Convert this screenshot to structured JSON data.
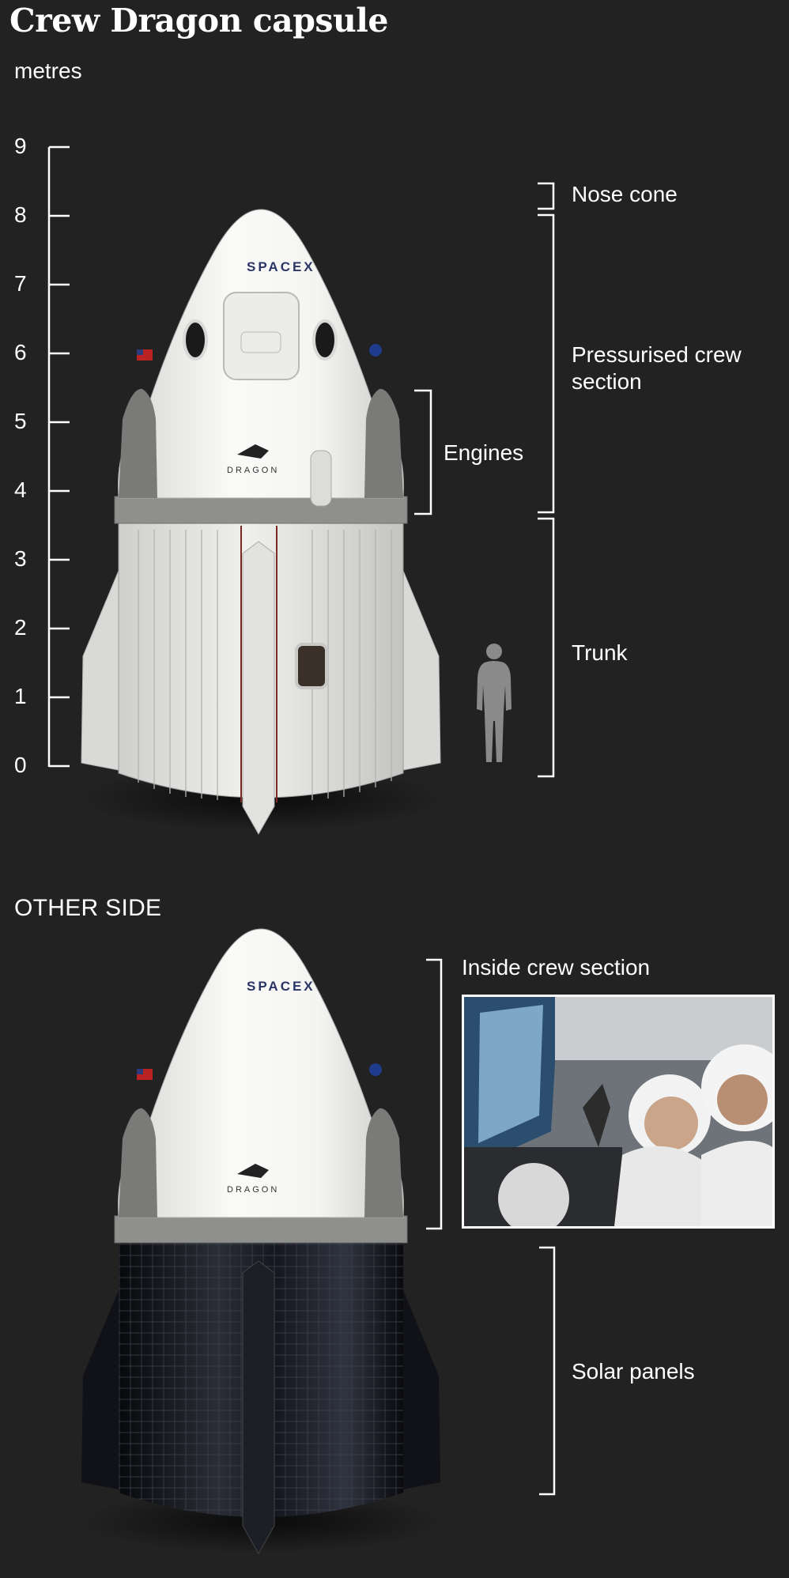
{
  "title": "Crew Dragon capsule",
  "units": "metres",
  "scale": {
    "ticks": [
      "0",
      "1",
      "2",
      "3",
      "4",
      "5",
      "6",
      "7",
      "8",
      "9"
    ]
  },
  "parts": {
    "nose_cone": "Nose cone",
    "pressurised": "Pressurised crew section",
    "engines": "Engines",
    "trunk": "Trunk"
  },
  "other_side": {
    "label": "OTHER SIDE",
    "inside_crew": "Inside crew section",
    "solar_panels": "Solar panels"
  },
  "capsule_markings": {
    "brand": "SPACEX",
    "model": "DRAGON"
  },
  "colors": {
    "background": "#222222",
    "capsule_white": "#f2f2f0",
    "heat_grey": "#8c8c8c",
    "solar_black": "#101116"
  }
}
